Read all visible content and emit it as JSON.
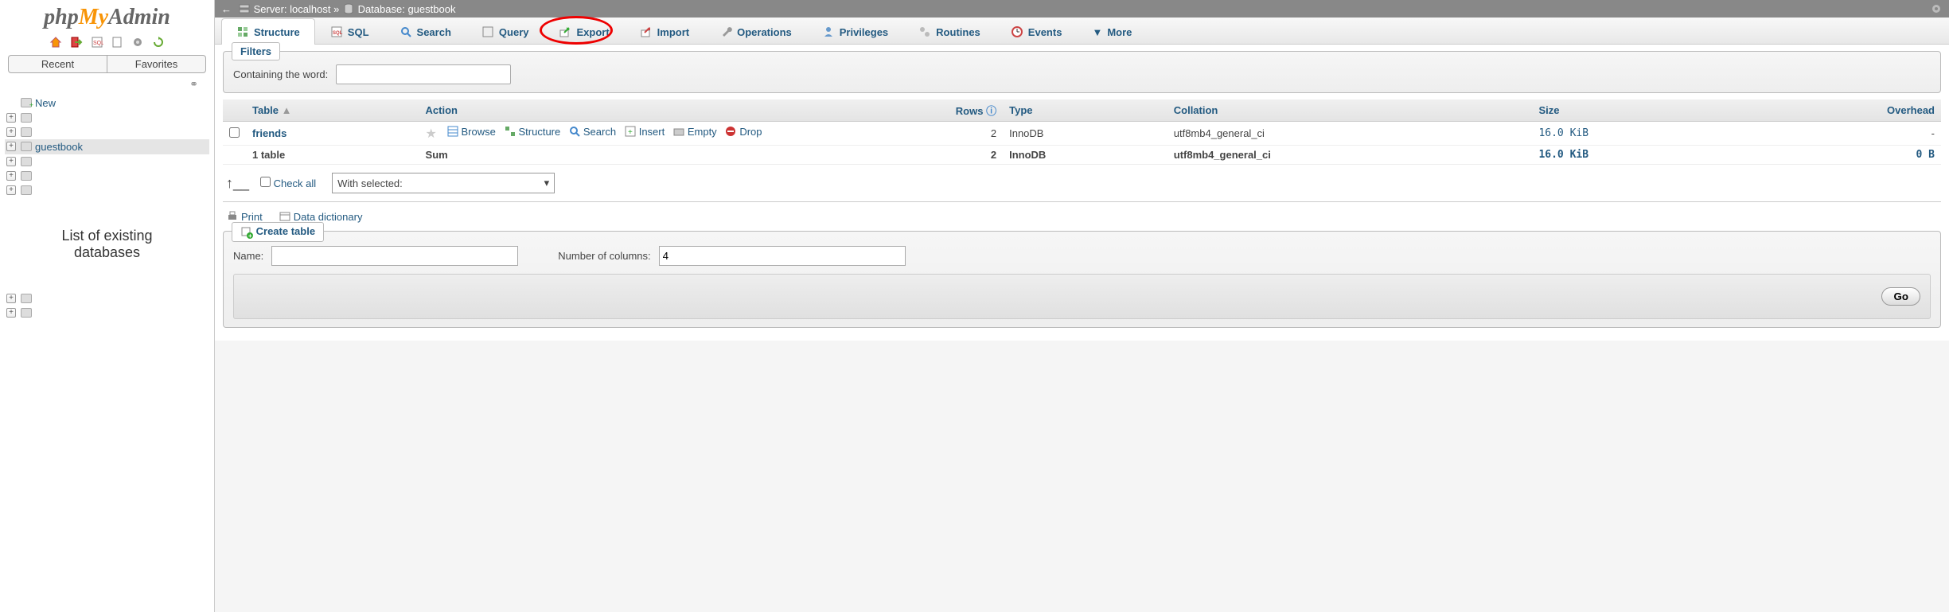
{
  "sidebar": {
    "logo_parts": {
      "p": "php",
      "m": "My",
      "a": "Admin"
    },
    "nav_tabs": {
      "recent": "Recent",
      "favorites": "Favorites"
    },
    "new_label": "New",
    "db_selected": "guestbook",
    "annotation": "List of existing databases"
  },
  "breadcrumb": {
    "server_label": "Server:",
    "server_value": "localhost",
    "db_label": "Database:",
    "db_value": "guestbook"
  },
  "tabs": [
    {
      "key": "structure",
      "label": "Structure"
    },
    {
      "key": "sql",
      "label": "SQL"
    },
    {
      "key": "search",
      "label": "Search"
    },
    {
      "key": "query",
      "label": "Query"
    },
    {
      "key": "export",
      "label": "Export"
    },
    {
      "key": "import",
      "label": "Import"
    },
    {
      "key": "operations",
      "label": "Operations"
    },
    {
      "key": "privileges",
      "label": "Privileges"
    },
    {
      "key": "routines",
      "label": "Routines"
    },
    {
      "key": "events",
      "label": "Events"
    },
    {
      "key": "more",
      "label": "More"
    }
  ],
  "filters": {
    "legend": "Filters",
    "label": "Containing the word:"
  },
  "tablelist": {
    "headers": {
      "table": "Table",
      "action": "Action",
      "rows": "Rows",
      "type": "Type",
      "collation": "Collation",
      "size": "Size",
      "overhead": "Overhead"
    },
    "rows": [
      {
        "name": "friends",
        "rows": "2",
        "type": "InnoDB",
        "collation": "utf8mb4_general_ci",
        "size": "16.0 KiB",
        "overhead": "-"
      }
    ],
    "actions": {
      "browse": "Browse",
      "structure": "Structure",
      "search": "Search",
      "insert": "Insert",
      "empty": "Empty",
      "drop": "Drop"
    },
    "sum": {
      "label": "1 table",
      "sum": "Sum",
      "rows": "2",
      "type": "InnoDB",
      "collation": "utf8mb4_general_ci",
      "size": "16.0 KiB",
      "overhead": "0 B"
    }
  },
  "checkall": {
    "label": "Check all",
    "select_placeholder": "With selected:"
  },
  "links": {
    "print": "Print",
    "dict": "Data dictionary"
  },
  "create": {
    "legend": "Create table",
    "name_label": "Name:",
    "cols_label": "Number of columns:",
    "cols_value": "4",
    "go": "Go"
  }
}
